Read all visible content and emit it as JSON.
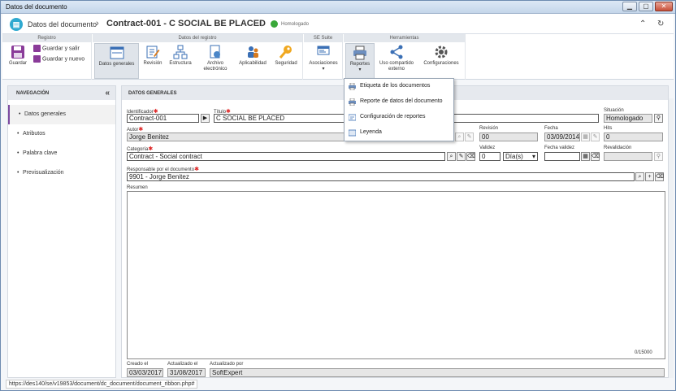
{
  "window": {
    "title": "Datos del documento",
    "btn_min": "▁",
    "btn_max": "▢",
    "btn_close": "✕"
  },
  "header": {
    "section": "Datos del documento",
    "document": "Contract-001 - C SOCIAL BE PLACED",
    "status": "Homologado",
    "collapse_icon": "chevrons-up-icon",
    "refresh_icon": "refresh-icon"
  },
  "ribbon": {
    "groups": {
      "registro": "Registro",
      "datos_registro": "Datos del registro",
      "se_suite": "SE Suite",
      "herramientas": "Herramientas"
    },
    "guardar": "Guardar",
    "guardar_salir": "Guardar y salir",
    "guardar_nuevo": "Guardar y nuevo",
    "datos_generales": "Datos generales",
    "revision": "Revisión",
    "estructura": "Estructura",
    "archivo_electronico": "Archivo electrónico",
    "aplicabilidad": "Aplicabilidad",
    "seguridad": "Seguridad",
    "asociaciones": "Asociaciones",
    "reportes": "Reportes",
    "uso_compartido": "Uso compartido externo",
    "configuraciones": "Configuraciones"
  },
  "nav": {
    "title": "NAVEGACIÓN",
    "items": [
      {
        "label": "Datos generales"
      },
      {
        "label": "Atributos"
      },
      {
        "label": "Palabra clave"
      },
      {
        "label": "Previsualización"
      }
    ]
  },
  "form": {
    "title": "DATOS GENERALES",
    "identificador_label": "Identificador",
    "identificador": "Contract-001",
    "titulo_label": "Título",
    "titulo": "C SOCIAL BE PLACED",
    "situacion_label": "Situación",
    "situacion": "Homologado",
    "autor_label": "Autor",
    "autor": "Jorge Benitez",
    "revision_label": "Revisión",
    "revision": "00",
    "fecha_label": "Fecha",
    "fecha": "03/09/2014",
    "hits_label": "Hits",
    "hits": "0",
    "categoria_label": "Categoría",
    "categoria": "Contract - Social contract",
    "validez_label": "Validez",
    "validez": "0",
    "validez_unit": "Día(s)",
    "fecha_validez_label": "Fecha validez",
    "fecha_validez": "",
    "revalidacion_label": "Revalidación",
    "revalidacion": "",
    "responsable_label": "Responsable por el documento",
    "responsable": "9901 - Jorge Benitez",
    "resumen_label": "Resumen",
    "resumen_counter": "0/15000",
    "creado_label": "Creado el",
    "creado": "03/03/2017",
    "actualizado_label": "Actualizado el",
    "actualizado": "31/08/2017",
    "actualizado_por_label": "Actualizado por",
    "actualizado_por": "SoftExpert"
  },
  "reportes_menu": [
    {
      "label": "Etiqueta de los documentos",
      "icon": "printer-icon"
    },
    {
      "label": "Reporte de datos del documento",
      "icon": "printer-icon"
    },
    {
      "label": "Configuración de reportes",
      "icon": "report-config-icon"
    },
    {
      "label": "Leyenda",
      "icon": "legend-icon"
    }
  ],
  "statusbar": {
    "url": "https://des140/se/v19853/document/dc_document/document_ribbon.php#"
  },
  "colors": {
    "accent": "#7c4aa1",
    "required": "#d22222",
    "status_green": "#3aa83a",
    "logo": "#2fa9d0"
  }
}
